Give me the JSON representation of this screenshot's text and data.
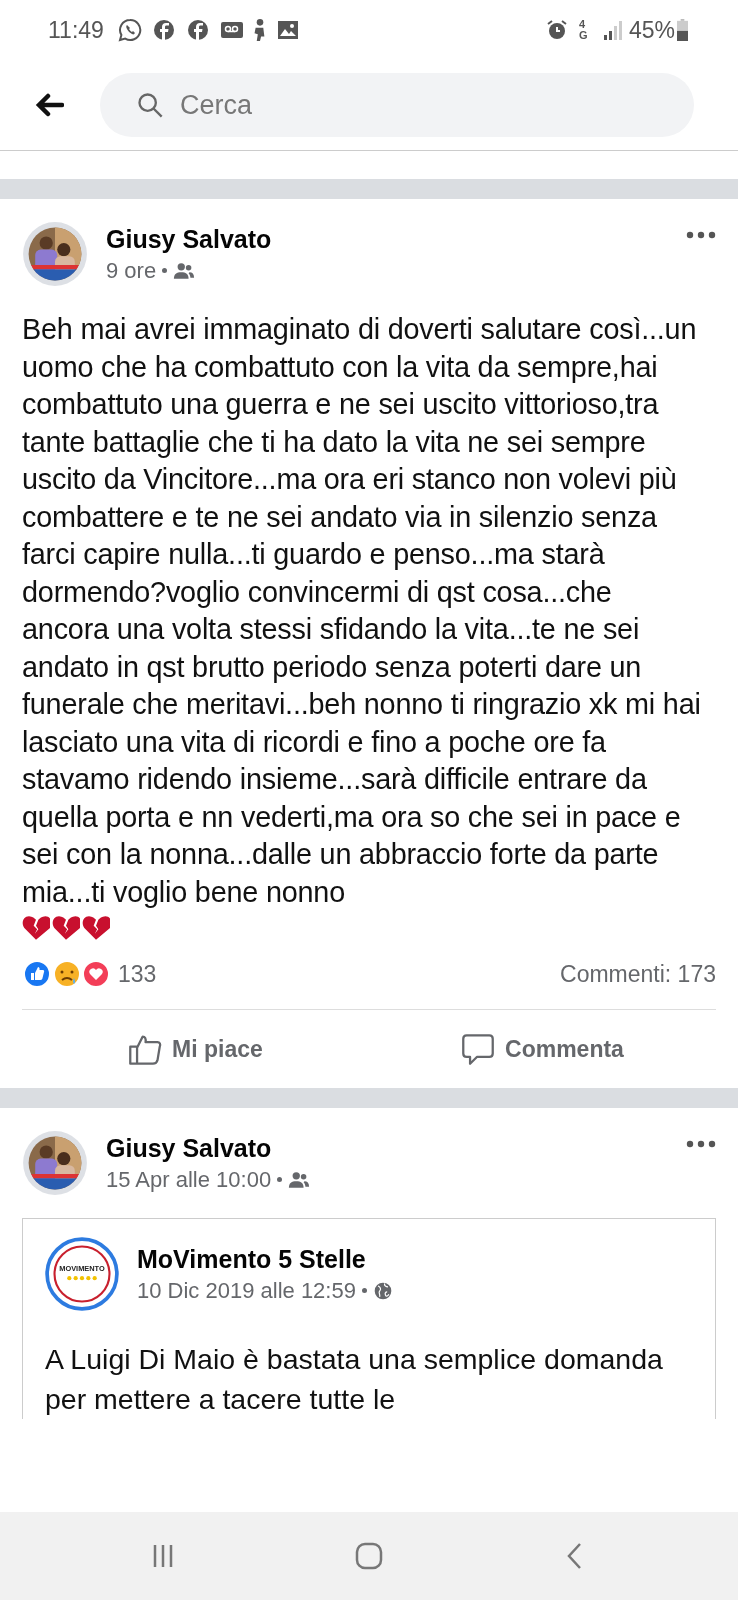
{
  "status_bar": {
    "time": "11:49",
    "network": "4G",
    "battery": "45%"
  },
  "search": {
    "placeholder": "Cerca"
  },
  "posts": [
    {
      "kind": "text",
      "author": "Giusy Salvato",
      "time": "9 ore",
      "text": "Beh mai avrei immaginato di doverti salutare così...un uomo che ha combattuto con la vita da sempre,hai combattuto una guerra e ne sei uscito vittorioso,tra tante battaglie che ti ha dato la vita ne sei sempre uscito da Vincitore...ma ora eri stanco non volevi più combattere e te ne sei andato via in silenzio senza farci capire nulla...ti guardo e penso...ma starà dormendo?voglio convincermi di qst cosa...che ancora una volta stessi sfidando la vita...te ne sei andato in qst brutto periodo senza poterti dare un funerale che meritavi...beh nonno ti ringrazio xk mi hai lasciato una vita di ricordi e fino a poche ore fa stavamo ridendo insieme...sarà difficile entrare da quella porta e nn vederti,ma ora so che sei in pace e sei con la nonna...dalle un abbraccio forte da parte mia...ti voglio bene nonno",
      "reactions_count": "133",
      "comments": "Commenti: 173",
      "actions": [
        "Mi piace",
        "Commenta"
      ]
    },
    {
      "kind": "share",
      "author": "Giusy Salvato",
      "time": "15 Apr alle 10:00",
      "shared": {
        "page": "MoVimento 5 Stelle",
        "logo_text": "MOVIMENTO",
        "time": "10 Dic 2019 alle 12:59",
        "text": "A Luigi Di Maio è bastata una semplice domanda per mettere a tacere tutte le"
      }
    }
  ]
}
